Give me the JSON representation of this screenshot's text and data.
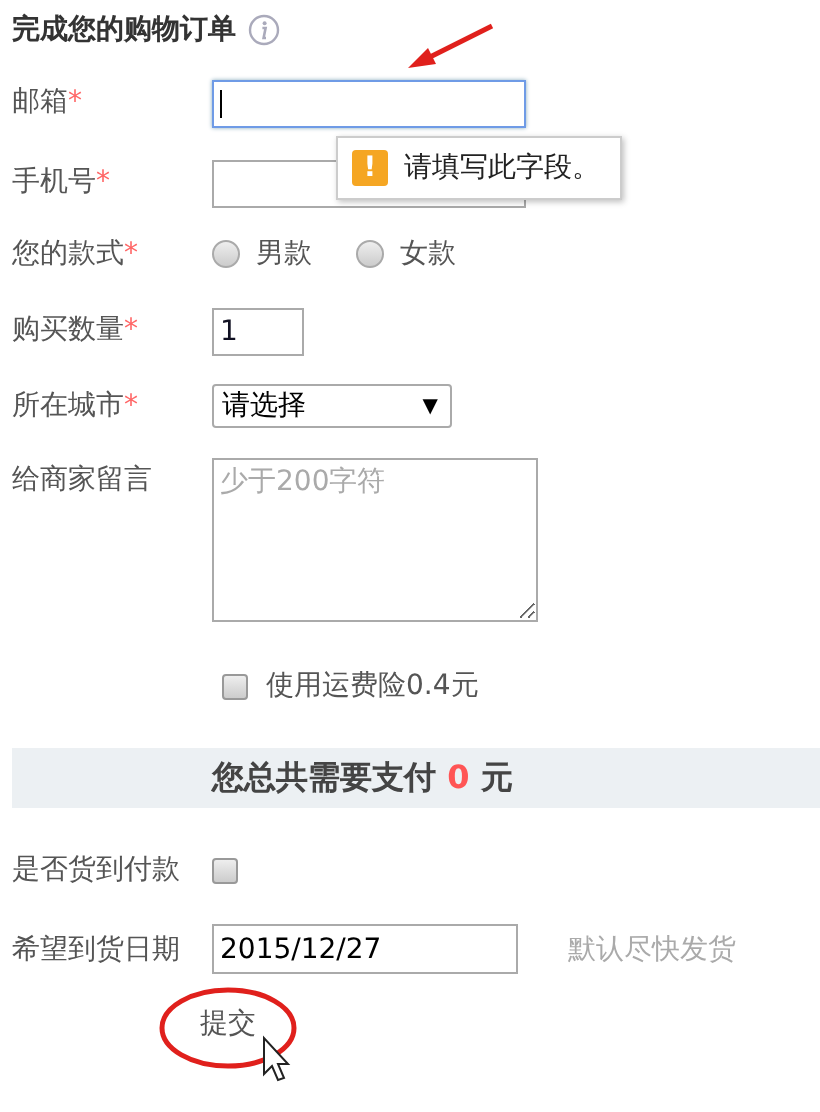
{
  "title": "完成您的购物订单",
  "required_mark": "*",
  "fields": [
    {
      "kind": "text",
      "label": "邮箱",
      "required": true,
      "focused": true
    },
    {
      "kind": "text",
      "label": "手机号",
      "required": true,
      "focused": false
    },
    {
      "kind": "radio",
      "label": "您的款式",
      "required": true,
      "options": [
        {
          "label": "男款",
          "selected": false
        },
        {
          "label": "女款",
          "selected": false
        }
      ]
    },
    {
      "kind": "number",
      "label": "购买数量",
      "required": true,
      "value": "1",
      "focused": false
    },
    {
      "kind": "select",
      "label": "所在城市",
      "required": true,
      "value": "请选择",
      "arrow": "▼"
    },
    {
      "kind": "textarea",
      "label": "给商家留言",
      "required": false,
      "placeholder": "少于200字符"
    }
  ],
  "tooltip": {
    "icon": "!",
    "text": "请填写此字段。"
  },
  "insurance": {
    "label": "使用运费险0.4元",
    "checked": false
  },
  "summary": {
    "before": "您总共需要支付",
    "amount": "0",
    "after": "元"
  },
  "cod": {
    "label": "是否货到付款",
    "checked": false
  },
  "date": {
    "label": "希望到货日期",
    "value": "2015/12/27",
    "hint": "默认尽快发货"
  },
  "submit": "提交"
}
